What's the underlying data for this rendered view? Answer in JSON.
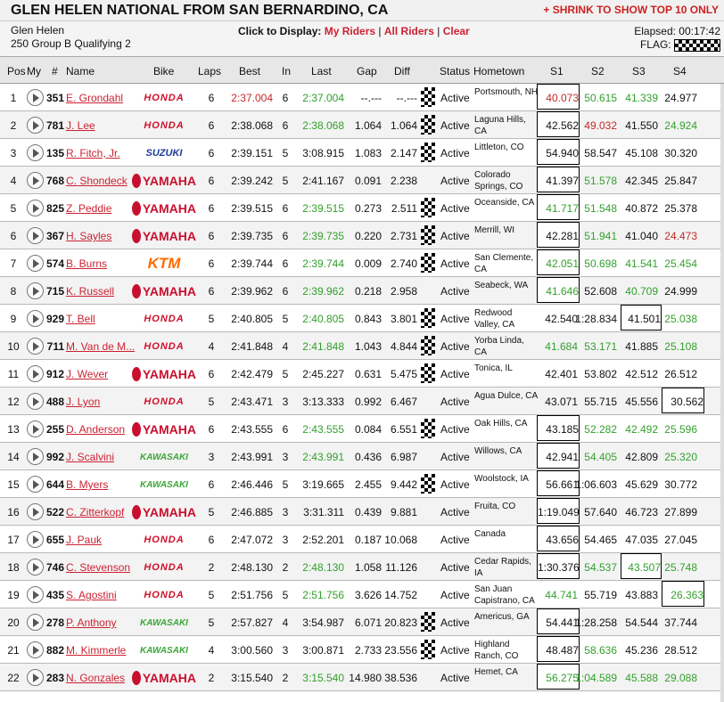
{
  "title": "GLEN HELEN NATIONAL FROM SAN BERNARDINO, CA",
  "shrink_link": "+ SHRINK TO SHOW TOP 10 ONLY",
  "venue": "Glen Helen",
  "session": "250 Group B Qualifying 2",
  "display": {
    "label": "Click to Display:",
    "my_riders": "My Riders",
    "all_riders": "All Riders",
    "clear": "Clear",
    "sep": "|"
  },
  "elapsed": "Elapsed: 00:17:42",
  "flag_label": "FLAG:",
  "headers": {
    "pos": "Pos",
    "my": "My",
    "num": "#",
    "name": "Name",
    "bike": "Bike",
    "laps": "Laps",
    "best": "Best",
    "in": "In",
    "last": "Last",
    "gap": "Gap",
    "diff": "Diff",
    "status": "Status",
    "hometown": "Hometown",
    "s1": "S1",
    "s2": "S2",
    "s3": "S3",
    "s4": "S4"
  },
  "colors": {
    "accent": "#cc2233",
    "green": "#33a02c",
    "red": "#c42a2a"
  },
  "rows": [
    {
      "pos": "1",
      "num": "351",
      "name": "E. Grondahl",
      "bike": "HONDA",
      "laps": "6",
      "best": "2:37.004",
      "best_red": true,
      "in": "6",
      "last": "2:37.004",
      "last_green": true,
      "gap": "--.---",
      "diff": "--.---",
      "flag": true,
      "status": "Active",
      "town": "Portsmouth, NH",
      "s1": "40.073",
      "s1c": "red",
      "s1b": true,
      "s2": "50.615",
      "s2c": "green",
      "s3": "41.339",
      "s3c": "green",
      "s4": "24.977",
      "s4c": ""
    },
    {
      "pos": "2",
      "num": "781",
      "name": "J. Lee",
      "bike": "HONDA",
      "laps": "6",
      "best": "2:38.068",
      "in": "6",
      "last": "2:38.068",
      "last_green": true,
      "gap": "1.064",
      "diff": "1.064",
      "flag": true,
      "status": "Active",
      "town": "Laguna Hills, CA",
      "s1": "42.562",
      "s1c": "",
      "s1b": true,
      "s2": "49.032",
      "s2c": "red",
      "s3": "41.550",
      "s3c": "",
      "s4": "24.924",
      "s4c": "green"
    },
    {
      "pos": "3",
      "num": "135",
      "name": "R. Fitch, Jr.",
      "bike": "SUZUKI",
      "laps": "6",
      "best": "2:39.151",
      "in": "5",
      "last": "3:08.915",
      "gap": "1.083",
      "diff": "2.147",
      "flag": true,
      "status": "Active",
      "town": "Littleton, CO",
      "s1": "54.940",
      "s1c": "",
      "s1b": true,
      "s2": "58.547",
      "s2c": "",
      "s3": "45.108",
      "s3c": "",
      "s4": "30.320",
      "s4c": ""
    },
    {
      "pos": "4",
      "num": "768",
      "name": "C. Shondeck",
      "bike": "YAMAHA",
      "laps": "6",
      "best": "2:39.242",
      "in": "5",
      "last": "2:41.167",
      "gap": "0.091",
      "diff": "2.238",
      "flag": false,
      "status": "Active",
      "town": "Colorado Springs, CO",
      "s1": "41.397",
      "s1c": "",
      "s1b": true,
      "s2": "51.578",
      "s2c": "green",
      "s3": "42.345",
      "s3c": "",
      "s4": "25.847",
      "s4c": ""
    },
    {
      "pos": "5",
      "num": "825",
      "name": "Z. Peddie",
      "bike": "YAMAHA",
      "laps": "6",
      "best": "2:39.515",
      "in": "6",
      "last": "2:39.515",
      "last_green": true,
      "gap": "0.273",
      "diff": "2.511",
      "flag": true,
      "status": "Active",
      "town": "Oceanside, CA",
      "s1": "41.717",
      "s1c": "green",
      "s1b": true,
      "s2": "51.548",
      "s2c": "green",
      "s3": "40.872",
      "s3c": "",
      "s4": "25.378",
      "s4c": ""
    },
    {
      "pos": "6",
      "num": "367",
      "name": "H. Sayles",
      "bike": "YAMAHA",
      "laps": "6",
      "best": "2:39.735",
      "in": "6",
      "last": "2:39.735",
      "last_green": true,
      "gap": "0.220",
      "diff": "2.731",
      "flag": true,
      "status": "Active",
      "town": "Merrill, WI",
      "s1": "42.281",
      "s1c": "",
      "s1b": true,
      "s2": "51.941",
      "s2c": "green",
      "s3": "41.040",
      "s3c": "",
      "s4": "24.473",
      "s4c": "red"
    },
    {
      "pos": "7",
      "num": "574",
      "name": "B. Burns",
      "bike": "KTM",
      "laps": "6",
      "best": "2:39.744",
      "in": "6",
      "last": "2:39.744",
      "last_green": true,
      "gap": "0.009",
      "diff": "2.740",
      "flag": true,
      "status": "Active",
      "town": "San Clemente, CA",
      "s1": "42.051",
      "s1c": "green",
      "s1b": true,
      "s2": "50.698",
      "s2c": "green",
      "s3": "41.541",
      "s3c": "green",
      "s4": "25.454",
      "s4c": "green"
    },
    {
      "pos": "8",
      "num": "715",
      "name": "K. Russell",
      "bike": "YAMAHA",
      "laps": "6",
      "best": "2:39.962",
      "in": "6",
      "last": "2:39.962",
      "last_green": true,
      "gap": "0.218",
      "diff": "2.958",
      "flag": false,
      "status": "Active",
      "town": "Seabeck, WA",
      "s1": "41.646",
      "s1c": "green",
      "s1b": true,
      "s2": "52.608",
      "s2c": "",
      "s3": "40.709",
      "s3c": "green",
      "s4": "24.999",
      "s4c": ""
    },
    {
      "pos": "9",
      "num": "929",
      "name": "T. Bell",
      "bike": "HONDA",
      "laps": "5",
      "best": "2:40.805",
      "in": "5",
      "last": "2:40.805",
      "last_green": true,
      "gap": "0.843",
      "diff": "3.801",
      "flag": true,
      "status": "Active",
      "town": "Redwood Valley, CA",
      "s1": "42.540",
      "s1c": "",
      "s2": "1:28.834",
      "s2c": "",
      "s3": "41.501",
      "s3c": "",
      "s3b": true,
      "s4": "25.038",
      "s4c": "green"
    },
    {
      "pos": "10",
      "num": "711",
      "name": "M. Van de M...",
      "bike": "HONDA",
      "laps": "4",
      "best": "2:41.848",
      "in": "4",
      "last": "2:41.848",
      "last_green": true,
      "gap": "1.043",
      "diff": "4.844",
      "flag": true,
      "status": "Active",
      "town": "Yorba Linda, CA",
      "s1": "41.684",
      "s1c": "green",
      "s2": "53.171",
      "s2c": "green",
      "s3": "41.885",
      "s3c": "",
      "s4": "25.108",
      "s4c": "green"
    },
    {
      "pos": "11",
      "num": "912",
      "name": "J. Wever",
      "bike": "YAMAHA",
      "laps": "6",
      "best": "2:42.479",
      "in": "5",
      "last": "2:45.227",
      "gap": "0.631",
      "diff": "5.475",
      "flag": true,
      "status": "Active",
      "town": "Tonica, IL",
      "s1": "42.401",
      "s1c": "",
      "s2": "53.802",
      "s2c": "",
      "s3": "42.512",
      "s3c": "",
      "s4": "26.512",
      "s4c": ""
    },
    {
      "pos": "12",
      "num": "488",
      "name": "J. Lyon",
      "bike": "HONDA",
      "laps": "5",
      "best": "2:43.471",
      "in": "3",
      "last": "3:13.333",
      "gap": "0.992",
      "diff": "6.467",
      "flag": false,
      "status": "Active",
      "town": "Agua Dulce, CA",
      "s1": "43.071",
      "s1c": "",
      "s2": "55.715",
      "s2c": "",
      "s3": "45.556",
      "s3c": "",
      "s4": "30.562",
      "s4c": "",
      "s4b": true
    },
    {
      "pos": "13",
      "num": "255",
      "name": "D. Anderson",
      "bike": "YAMAHA",
      "laps": "6",
      "best": "2:43.555",
      "in": "6",
      "last": "2:43.555",
      "last_green": true,
      "gap": "0.084",
      "diff": "6.551",
      "flag": true,
      "status": "Active",
      "town": "Oak Hills, CA",
      "s1": "43.185",
      "s1c": "",
      "s1b": true,
      "s2": "52.282",
      "s2c": "green",
      "s3": "42.492",
      "s3c": "green",
      "s4": "25.596",
      "s4c": "green"
    },
    {
      "pos": "14",
      "num": "992",
      "name": "J. Scalvini",
      "bike": "KAWASAKI",
      "laps": "3",
      "best": "2:43.991",
      "in": "3",
      "last": "2:43.991",
      "last_green": true,
      "gap": "0.436",
      "diff": "6.987",
      "flag": false,
      "status": "Active",
      "town": "Willows, CA",
      "s1": "42.941",
      "s1c": "",
      "s1b": true,
      "s2": "54.405",
      "s2c": "green",
      "s3": "42.809",
      "s3c": "",
      "s4": "25.320",
      "s4c": "green"
    },
    {
      "pos": "15",
      "num": "644",
      "name": "B. Myers",
      "bike": "KAWASAKI",
      "laps": "6",
      "best": "2:46.446",
      "in": "5",
      "last": "3:19.665",
      "gap": "2.455",
      "diff": "9.442",
      "flag": true,
      "status": "Active",
      "town": "Woolstock, IA",
      "s1": "56.661",
      "s1c": "",
      "s1b": true,
      "s2": "1:06.603",
      "s2c": "",
      "s3": "45.629",
      "s3c": "",
      "s4": "30.772",
      "s4c": ""
    },
    {
      "pos": "16",
      "num": "522",
      "name": "C. Zitterkopf",
      "bike": "YAMAHA",
      "laps": "5",
      "best": "2:46.885",
      "in": "3",
      "last": "3:31.311",
      "gap": "0.439",
      "diff": "9.881",
      "flag": false,
      "status": "Active",
      "town": "Fruita, CO",
      "s1": "1:19.049",
      "s1c": "",
      "s1b": true,
      "s2": "57.640",
      "s2c": "",
      "s3": "46.723",
      "s3c": "",
      "s4": "27.899",
      "s4c": ""
    },
    {
      "pos": "17",
      "num": "655",
      "name": "J. Pauk",
      "bike": "HONDA",
      "laps": "6",
      "best": "2:47.072",
      "in": "3",
      "last": "2:52.201",
      "gap": "0.187",
      "diff": "10.068",
      "flag": false,
      "status": "Active",
      "town": "Canada",
      "s1": "43.656",
      "s1c": "",
      "s1b": true,
      "s2": "54.465",
      "s2c": "",
      "s3": "47.035",
      "s3c": "",
      "s4": "27.045",
      "s4c": ""
    },
    {
      "pos": "18",
      "num": "746",
      "name": "C. Stevenson",
      "bike": "HONDA",
      "laps": "2",
      "best": "2:48.130",
      "in": "2",
      "last": "2:48.130",
      "last_green": true,
      "gap": "1.058",
      "diff": "11.126",
      "flag": false,
      "status": "Active",
      "town": "Cedar Rapids, IA",
      "s1": "1:30.376",
      "s1c": "",
      "s1b": true,
      "s2": "54.537",
      "s2c": "green",
      "s3": "43.507",
      "s3c": "green",
      "s3b": true,
      "s4": "25.748",
      "s4c": "green"
    },
    {
      "pos": "19",
      "num": "435",
      "name": "S. Agostini",
      "bike": "HONDA",
      "laps": "5",
      "best": "2:51.756",
      "in": "5",
      "last": "2:51.756",
      "last_green": true,
      "gap": "3.626",
      "diff": "14.752",
      "flag": false,
      "status": "Active",
      "town": "San Juan Capistrano, CA",
      "s1": "44.741",
      "s1c": "green",
      "s2": "55.719",
      "s2c": "",
      "s3": "43.883",
      "s3c": "",
      "s4": "26.363",
      "s4c": "green",
      "s4b": true
    },
    {
      "pos": "20",
      "num": "278",
      "name": "P. Anthony",
      "bike": "KAWASAKI",
      "laps": "5",
      "best": "2:57.827",
      "in": "4",
      "last": "3:54.987",
      "gap": "6.071",
      "diff": "20.823",
      "flag": true,
      "status": "Active",
      "town": "Americus, GA",
      "s1": "54.441",
      "s1c": "",
      "s1b": true,
      "s2": "1:28.258",
      "s2c": "",
      "s3": "54.544",
      "s3c": "",
      "s4": "37.744",
      "s4c": ""
    },
    {
      "pos": "21",
      "num": "882",
      "name": "M. Kimmerle",
      "bike": "KAWASAKI",
      "laps": "4",
      "best": "3:00.560",
      "in": "3",
      "last": "3:00.871",
      "gap": "2.733",
      "diff": "23.556",
      "flag": true,
      "status": "Active",
      "town": "Highland Ranch, CO",
      "s1": "48.487",
      "s1c": "",
      "s1b": true,
      "s2": "58.636",
      "s2c": "green",
      "s3": "45.236",
      "s3c": "",
      "s4": "28.512",
      "s4c": ""
    },
    {
      "pos": "22",
      "num": "283",
      "name": "N. Gonzales",
      "bike": "YAMAHA",
      "laps": "2",
      "best": "3:15.540",
      "in": "2",
      "last": "3:15.540",
      "last_green": true,
      "gap": "14.980",
      "diff": "38.536",
      "flag": false,
      "status": "Active",
      "town": "Hemet, CA",
      "s1": "56.275",
      "s1c": "green",
      "s1b": true,
      "s2": "1:04.589",
      "s2c": "green",
      "s3": "45.588",
      "s3c": "green",
      "s4": "29.088",
      "s4c": "green"
    }
  ]
}
